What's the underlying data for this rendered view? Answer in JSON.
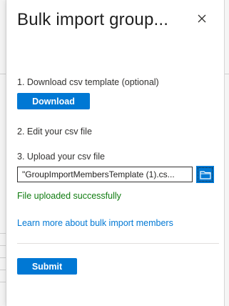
{
  "panel": {
    "title": "Bulk import group...",
    "close_icon": "close-icon"
  },
  "steps": {
    "step1_label": "1. Download csv template (optional)",
    "download_label": "Download",
    "step2_label": "2. Edit your csv file",
    "step3_label": "3. Upload your csv file",
    "file_value": "\"GroupImportMembersTemplate (1).cs...",
    "folder_icon": "folder-icon"
  },
  "status": {
    "message": "File uploaded successfully"
  },
  "links": {
    "learn_more": "Learn more about bulk import members"
  },
  "footer": {
    "submit_label": "Submit"
  },
  "colors": {
    "accent": "#0078d4",
    "success": "#107c10",
    "text": "#323130"
  }
}
